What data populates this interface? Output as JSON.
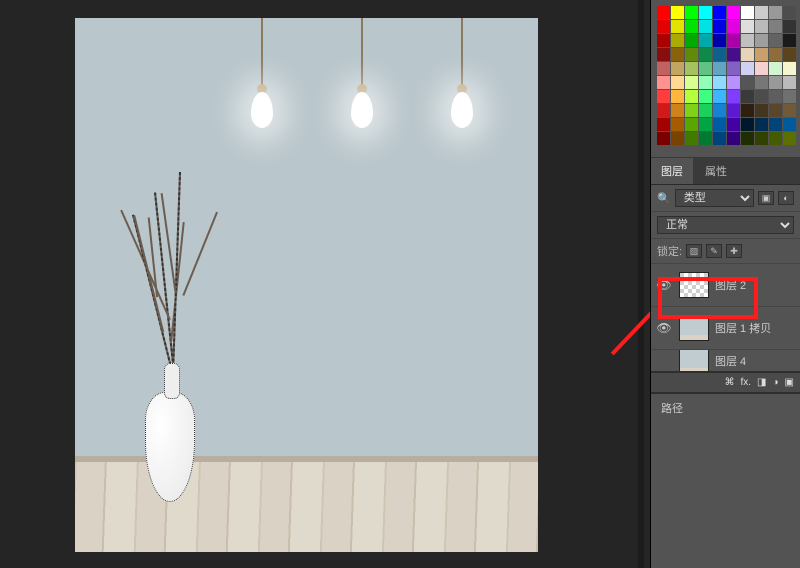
{
  "panels": {
    "layers_tab": "图层",
    "properties_tab": "属性",
    "search_icon": "🔍",
    "filter_label": "类型",
    "blend_mode": "正常",
    "lock_label": "锁定:",
    "paths_tab": "路径"
  },
  "layers": {
    "row1": {
      "name": "图层 2"
    },
    "row2": {
      "name": "图层 1 拷贝"
    },
    "row3": {
      "name": "图层 4"
    }
  },
  "footer_icons": [
    "⌘",
    "fx.",
    "◨",
    "◑",
    "▣"
  ]
}
